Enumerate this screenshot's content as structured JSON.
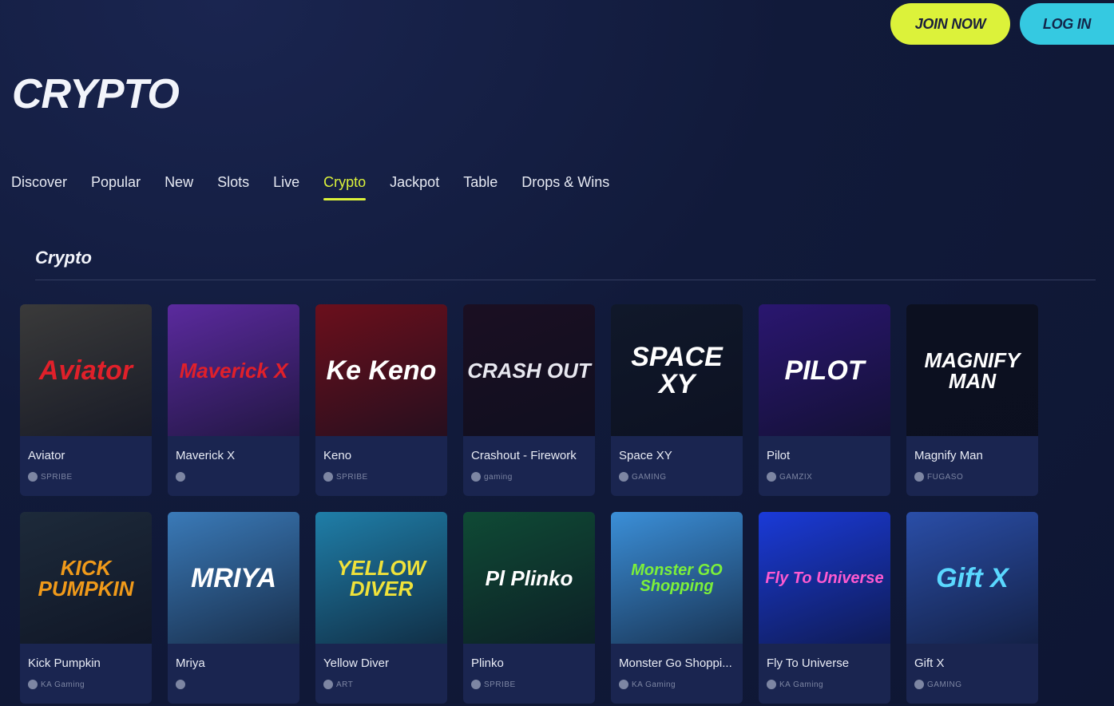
{
  "auth": {
    "join_label": "JOIN NOW",
    "login_label": "LOG IN"
  },
  "page_title": "CRYPTO",
  "tabs": [
    {
      "label": "Discover"
    },
    {
      "label": "Popular"
    },
    {
      "label": "New"
    },
    {
      "label": "Slots"
    },
    {
      "label": "Live"
    },
    {
      "label": "Crypto",
      "active": true
    },
    {
      "label": "Jackpot"
    },
    {
      "label": "Table"
    },
    {
      "label": "Drops & Wins"
    }
  ],
  "section_title": "Crypto",
  "games": [
    {
      "name": "Aviator",
      "provider": "SPRIBE",
      "thumb_text": "Aviator",
      "bg": "#3a3a3a",
      "fg": "#e0202a"
    },
    {
      "name": "Maverick X",
      "provider": "",
      "thumb_text": "Maverick X",
      "bg": "#5b2a9e",
      "fg": "#e0202a"
    },
    {
      "name": "Keno",
      "provider": "SPRIBE",
      "thumb_text": "Ke Keno",
      "bg": "#6b0f1c",
      "fg": "#ffffff"
    },
    {
      "name": "Crashout - Firework",
      "provider": "gaming",
      "thumb_text": "CRASH OUT",
      "bg": "#1b0f22",
      "fg": "#e8e8f0"
    },
    {
      "name": "Space XY",
      "provider": "GAMING",
      "thumb_text": "SPACE XY",
      "bg": "#10182a",
      "fg": "#ffffff"
    },
    {
      "name": "Pilot",
      "provider": "GAMZIX",
      "thumb_text": "PILOT",
      "bg": "#2a1670",
      "fg": "#ffffff"
    },
    {
      "name": "Magnify Man",
      "provider": "FUGASO",
      "thumb_text": "MAGNIFY MAN",
      "bg": "#0c1020",
      "fg": "#ffffff"
    },
    {
      "name": "Kick Pumpkin",
      "provider": "KA Gaming",
      "thumb_text": "KICK PUMPKIN",
      "bg": "#1d2a3a",
      "fg": "#f09a1a"
    },
    {
      "name": "Mriya",
      "provider": "",
      "thumb_text": "MRIYA",
      "bg": "#3a7ab8",
      "fg": "#ffffff"
    },
    {
      "name": "Yellow Diver",
      "provider": "ART",
      "thumb_text": "YELLOW DIVER",
      "bg": "#1f7ea8",
      "fg": "#f0e23a"
    },
    {
      "name": "Plinko",
      "provider": "SPRIBE",
      "thumb_text": "Pl Plinko",
      "bg": "#0f4a35",
      "fg": "#ffffff"
    },
    {
      "name": "Monster Go Shoppi...",
      "provider": "KA Gaming",
      "thumb_text": "Monster GO Shopping",
      "bg": "#3b8fd8",
      "fg": "#7cf03a"
    },
    {
      "name": "Fly To Universe",
      "provider": "KA Gaming",
      "thumb_text": "Fly To Universe",
      "bg": "#1a3ad8",
      "fg": "#ff5ad0"
    },
    {
      "name": "Gift X",
      "provider": "GAMING",
      "thumb_text": "Gift X",
      "bg": "#2a4ea8",
      "fg": "#5ad8ff"
    }
  ]
}
